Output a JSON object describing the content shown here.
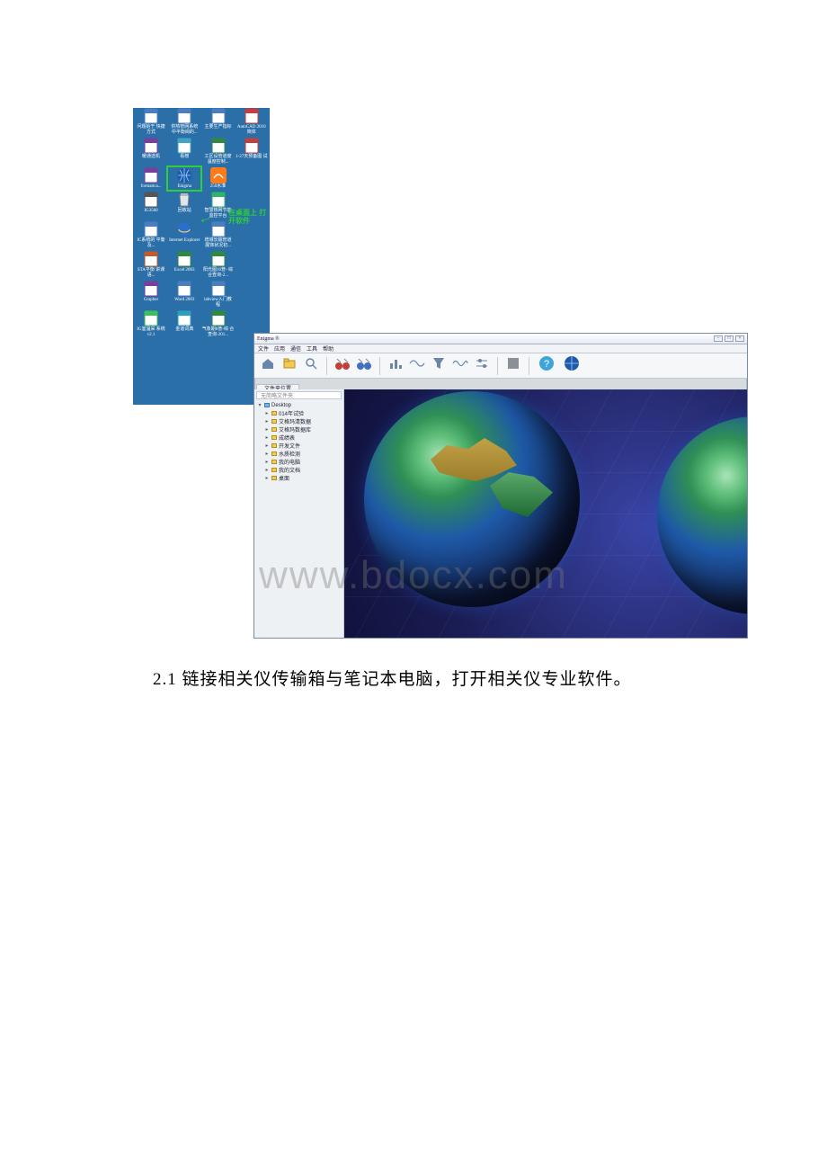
{
  "desktop": {
    "highlight_callout": "在桌面上\n打开软件",
    "icons": {
      "row0": [
        {
          "label": "问题始于\n快捷方式",
          "type": "doc"
        },
        {
          "label": "供热管网系统\n中平衡阀的...",
          "type": "doc"
        },
        {
          "label": "主要生产指标",
          "type": "doc"
        },
        {
          "label": "AutoCAD 2010\n简体",
          "type": "cad"
        }
      ],
      "row1": [
        {
          "label": "暖通选机",
          "type": "rar"
        },
        {
          "label": "看榜",
          "type": "img"
        },
        {
          "label": "工区设管道度\n温度控制...",
          "type": "xls"
        },
        {
          "label": "1-27天预备图\n试",
          "type": "cad"
        }
      ],
      "row2": [
        {
          "label": "formatica...",
          "type": "rar"
        },
        {
          "label": "Enigma",
          "type": "globe",
          "highlight": true
        },
        {
          "label": "250水准",
          "type": "orange"
        },
        {
          "label": "",
          "type": "none"
        }
      ],
      "row3": [
        {
          "label": "IG3560",
          "type": "dev"
        },
        {
          "label": "回收站",
          "type": "bin"
        },
        {
          "label": "智慧热网节能\n监控平台",
          "type": "app"
        },
        {
          "label": "",
          "type": "none"
        }
      ],
      "row4": [
        {
          "label": "IC系统的\n平衡及...",
          "type": "doc"
        },
        {
          "label": "Internet\nExplorer",
          "type": "ie"
        },
        {
          "label": "增城长输管道\n展饰状况初...",
          "type": "doc"
        },
        {
          "label": "",
          "type": "none"
        }
      ],
      "row5": [
        {
          "label": "STA平衡\n讲课语...",
          "type": "ppt"
        },
        {
          "label": "Excel 2003",
          "type": "xls"
        },
        {
          "label": "阳光图16普-\n综合查询-2...",
          "type": "xls"
        },
        {
          "label": "",
          "type": "none"
        }
      ],
      "row6": [
        {
          "label": "Grapher",
          "type": "rar"
        },
        {
          "label": "Word 2003",
          "type": "doc"
        },
        {
          "label": "labview入门教\n程",
          "type": "doc"
        },
        {
          "label": "",
          "type": "none"
        }
      ],
      "row7": [
        {
          "label": "IG室温采\n系统 v2.1",
          "type": "green"
        },
        {
          "label": "金道词典",
          "type": "dict"
        },
        {
          "label": "气象期8普-综\n合查询-201...",
          "type": "xls"
        },
        {
          "label": "",
          "type": "none"
        }
      ]
    }
  },
  "app": {
    "title": "Enigma ®",
    "menu": [
      "文件",
      "应用",
      "通信",
      "工具",
      "帮助"
    ],
    "toolbar": [
      {
        "name": "home-icon"
      },
      {
        "name": "open-icon"
      },
      {
        "name": "search-icon"
      },
      {
        "sep": true
      },
      {
        "name": "sensor-red-icon"
      },
      {
        "name": "sensor-blue-icon"
      },
      {
        "sep": true
      },
      {
        "name": "chart-icon"
      },
      {
        "name": "wave1-icon"
      },
      {
        "name": "filter-icon"
      },
      {
        "name": "wave2-icon"
      },
      {
        "name": "adjust-icon"
      },
      {
        "sep": true
      },
      {
        "name": "stop-icon"
      },
      {
        "sep": true
      },
      {
        "name": "help-icon"
      },
      {
        "name": "globe-icon"
      }
    ],
    "tab_label": "文件夹位置",
    "sidebar": {
      "search_placeholder": "无简略文件夹",
      "root": "Desktop",
      "items": [
        "014年试验",
        "艾格玛清数据",
        "艾格玛数据库",
        "成绩表",
        "开发文件",
        "水质检测",
        "我的电脑",
        "我的文档",
        "桌面"
      ]
    },
    "window_controls": [
      "–",
      "□",
      "×"
    ]
  },
  "watermark": "www.bdocx.com",
  "caption": "2.1 链接相关仪传输箱与笔记本电脑，打开相关仪专业软件。"
}
